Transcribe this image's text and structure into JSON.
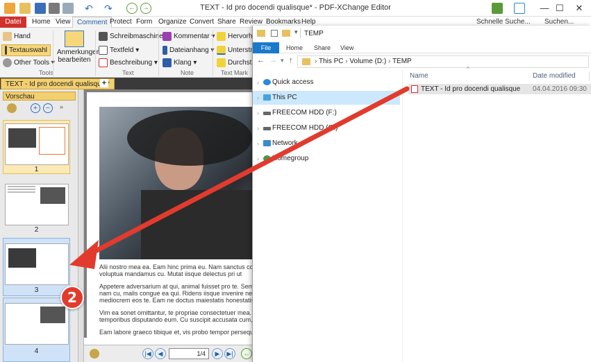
{
  "app": {
    "title": "TEXT - Id pro docendi qualisque* - PDF-XChange Editor",
    "window_buttons": {
      "minimize": "—",
      "maximize": "☐",
      "close": "✕"
    },
    "menu": [
      "Datei",
      "Home",
      "View",
      "Comment",
      "Protect",
      "Form",
      "Organize",
      "Convert",
      "Share",
      "Review",
      "Bookmarks",
      "Help"
    ],
    "active_menu": "Comment",
    "search1": "Schnelle Suche...",
    "search2": "Suchen..."
  },
  "ribbon": {
    "tools": {
      "hand": "Hand",
      "textauswahl": "Textauswahl",
      "other_tools": "Other Tools",
      "group": "Tools"
    },
    "anmerkungen": {
      "line1": "Anmerkungen",
      "line2": "bearbeiten"
    },
    "text_group": {
      "schreibmaschine": "Schreibmaschine",
      "textfeld": "Textfeld",
      "beschreibung": "Beschreibung",
      "group": "Text"
    },
    "note_group": {
      "kommentar": "Kommentar",
      "dateianhang": "Dateianhang",
      "klang": "Klang",
      "group": "Note"
    },
    "markup_group": {
      "hervorheben": "Hervorhe",
      "unterstreichen": "Unterstre",
      "durchstreichen": "Durchstr",
      "group": "Text Mark"
    }
  },
  "document_tab": "TEXT - Id pro docendi qualisque *",
  "sidebar": {
    "title": "Vorschau",
    "pages": [
      "1",
      "2",
      "3",
      "4"
    ]
  },
  "page_text": [
    "Alii nostro mea ea. Eam hinc prima eu. Nam sanctus concludaturque",
    "voluptua mandamus cu. Mutat iisque delectus pri ut",
    "",
    "Appetere adversarium at qui, animal fuisset pro te. Semper nominati",
    "nam cu, malis congue ea qui. Ridens iisque invenire nec ei. Ut duis",
    "mediocrem eos te. Eam ne doctus maiestatis honestatis, utroque dec",
    "",
    "Vim ea sonet omittantur, te propriae consectetuer mea. Id quo modo",
    "temporibus disputando eum. Cu suscipit accusata cum, ad meis possit",
    "",
    "Eam labore graeco tibique et, vis probo tempor persequeris te. E"
  ],
  "page_field": "1/4",
  "explorer": {
    "folder_title": "TEMP",
    "tabs": [
      "File",
      "Home",
      "Share",
      "View"
    ],
    "path": [
      "This PC",
      "Volume (D:)",
      "TEMP"
    ],
    "nav": [
      "Quick access",
      "This PC",
      "FREECOM HDD (F:)",
      "FREECOM HDD (G:)",
      "Network",
      "Homegroup"
    ],
    "columns": {
      "name": "Name",
      "date": "Date modified"
    },
    "file": {
      "name": "TEXT - Id pro docendi qualisque",
      "date": "04.04.2016 09:30"
    }
  },
  "callout": "2",
  "colors": {
    "accent_red": "#e23b2e",
    "tab_yellow": "#f2cf6f",
    "explorer_blue": "#1979ca"
  }
}
